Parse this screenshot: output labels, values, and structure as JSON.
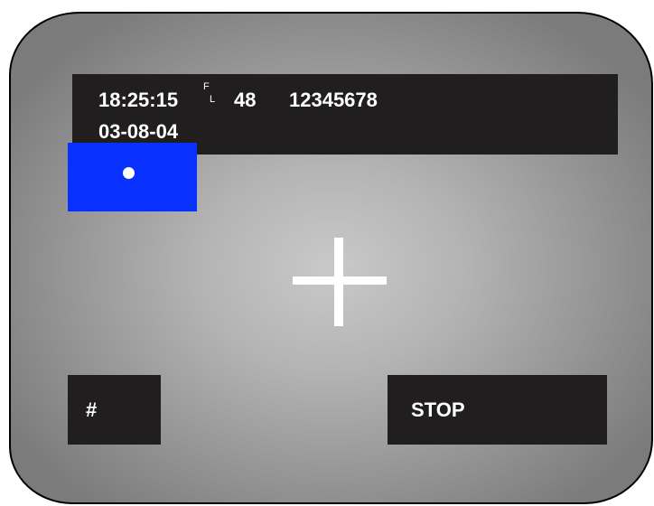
{
  "status": {
    "time": "18:25:15",
    "flag_top": "F",
    "flag_bottom": "L",
    "value": "48",
    "id_number": "12345678",
    "date": "03-08-04"
  },
  "indicator": {
    "color": "#0831ff",
    "icon": "record-dot-icon"
  },
  "crosshair": {
    "icon": "crosshair-icon",
    "color": "#ffffff"
  },
  "buttons": {
    "hash_label": "#",
    "stop_label": "STOP"
  },
  "colors": {
    "bar": "#201e1f",
    "text": "#ffffff"
  }
}
